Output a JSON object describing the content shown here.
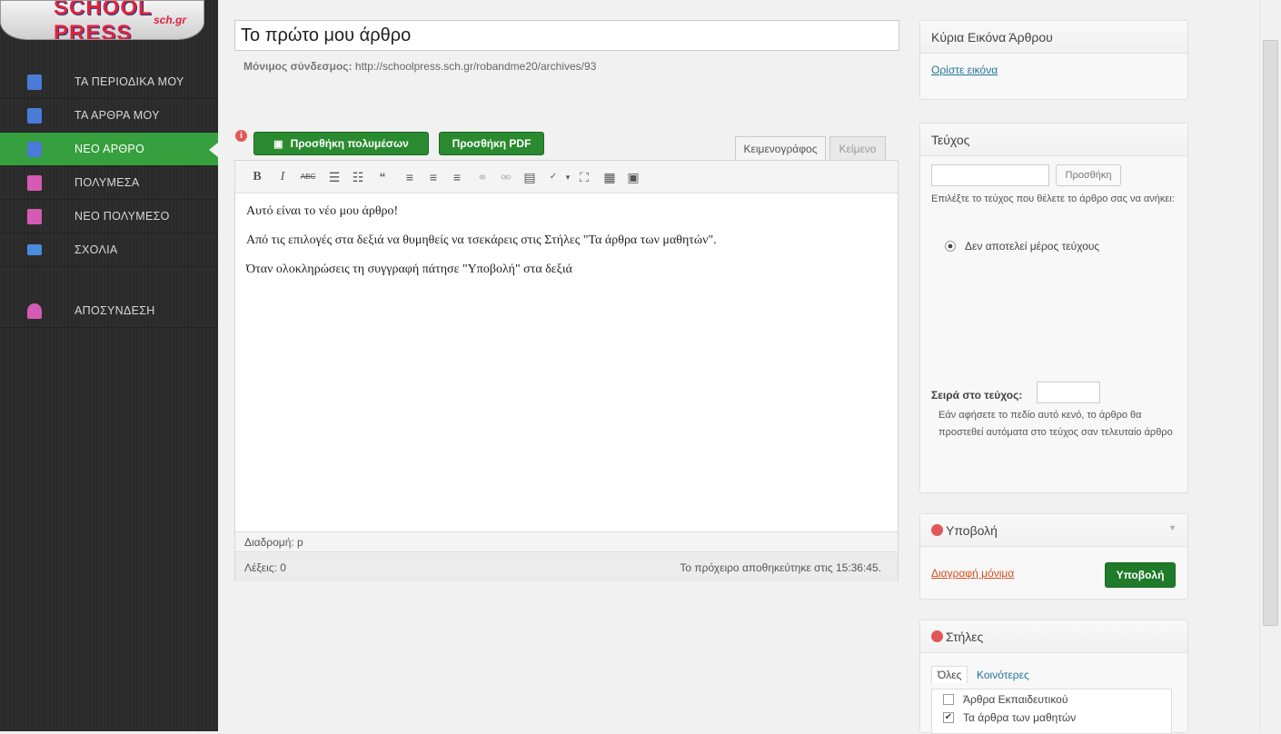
{
  "logo": {
    "text": "SCHOOL PRESS",
    "sub": "sch.gr"
  },
  "sidebar": {
    "items": [
      {
        "label": "ΤΑ ΠΕΡΙΟΔΙΚΑ ΜΟΥ",
        "icon": "book-icon",
        "color": "#4a7bd6"
      },
      {
        "label": "ΤΑ ΑΡΘΡΑ ΜΟΥ",
        "icon": "article-pen-icon",
        "color": "#4a7bd6"
      },
      {
        "label": "ΝΕΟ ΑΡΘΡΟ",
        "icon": "new-article-icon",
        "color": "#4a7bd6"
      },
      {
        "label": "ΠΟΛΥΜΕΣΑ",
        "icon": "media-camera-icon",
        "color": "#d65ab4"
      },
      {
        "label": "ΝΕΟ ΠΟΛΥΜΕΣΟ",
        "icon": "new-media-icon",
        "color": "#d65ab4"
      },
      {
        "label": "ΣΧΟΛΙΑ",
        "icon": "comments-icon",
        "color": "#4a8be0"
      },
      {
        "label": "ΑΠΟΣΥΝΔΕΣΗ",
        "icon": "logout-users-icon",
        "color": "#d65ab4"
      }
    ],
    "active_index": 2
  },
  "post": {
    "title": "Το πρώτο μου άρθρο",
    "permalink_label": "Μόνιμος σύνδεσμος:",
    "permalink_url": "http://schoolpress.sch.gr/robandme20/archives/93"
  },
  "editor": {
    "add_media_label": "Προσθήκη πολυμέσων",
    "add_pdf_label": "Προσθήκη PDF",
    "tab_visual": "Κειμενογράφος",
    "tab_text": "Κείμενο",
    "paragraphs": [
      "Αυτό είναι το νέο μου άρθρο!",
      "Από τις επιλογές στα δεξιά να θυμηθείς να τσεκάρεις στις Στήλες \"Τα άρθρα των μαθητών\".",
      "Όταν ολοκληρώσεις τη συγγραφή πάτησε \"Υποβολή\" στα δεξιά"
    ],
    "path_label": "Διαδρομή: p",
    "word_count": "Λέξεις: 0",
    "draft_saved": "Το πρόχειρο αποθηκεύτηκε στις 15:36:45."
  },
  "featured_image": {
    "title": "Κύρια Εικόνα Άρθρου",
    "set_link": "Ορίστε εικόνα"
  },
  "issue": {
    "title": "Τεύχος",
    "add_button": "Προσθήκη",
    "help": "Επιλέξτε το τεύχος που θέλετε το άρθρο σας να ανήκει:",
    "option": "Δεν αποτελεί μέρος τεύχους",
    "order_label": "Σειρά στο τεύχος:",
    "order_help": "Εάν αφήσετε το πεδίο αυτό κενό, το άρθρο θα προστεθεί αυτόματα στο τεύχος σαν τελευταίο άρθρο"
  },
  "publish": {
    "title": "Υποβολή",
    "delete_link": "Διαγραφή μόνιμα",
    "submit_button": "Υποβολή"
  },
  "columns": {
    "title": "Στήλες",
    "tab_all": "Όλες",
    "tab_popular": "Κοινότερες",
    "items": [
      {
        "label": "Άρθρα Εκπαιδευτικού",
        "checked": false
      },
      {
        "label": "Τα άρθρα των μαθητών",
        "checked": true
      }
    ]
  }
}
